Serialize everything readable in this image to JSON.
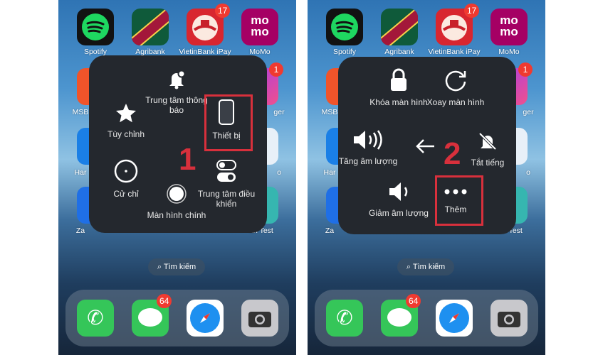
{
  "apps_row1": [
    {
      "label": "Spotify",
      "color": "#121212"
    },
    {
      "label": "Agribank",
      "color": "#a3173a"
    },
    {
      "label": "VietinBank iPay",
      "color": "#d8262f",
      "badge": "17"
    },
    {
      "label": "MoMo",
      "color": "#a50064"
    }
  ],
  "partial_labels": {
    "r2c1": "MSB",
    "r2c4": "ger",
    "r3c1": "Har",
    "r3c4": "o",
    "r4c1": "Za",
    "r4c4": "an Test"
  },
  "r2c4_badge": "1",
  "search_label": "Tìm kiếm",
  "dock": {
    "messages_badge": "64"
  },
  "menu1": {
    "items": [
      "Trung tâm thông báo",
      "Tùy chỉnh",
      "Thiết bị",
      "Cử chỉ",
      "Trung tâm điều khiển",
      "Màn hình chính"
    ],
    "step": "1"
  },
  "menu2": {
    "items": [
      "Khóa màn hình",
      "Xoay màn hình",
      "Tăng âm lượng",
      "Tắt tiếng",
      "Giảm âm lượng",
      "Thêm"
    ],
    "step": "2"
  },
  "colors": {
    "highlight": "#d8303c",
    "menu_bg": "#24282e"
  }
}
